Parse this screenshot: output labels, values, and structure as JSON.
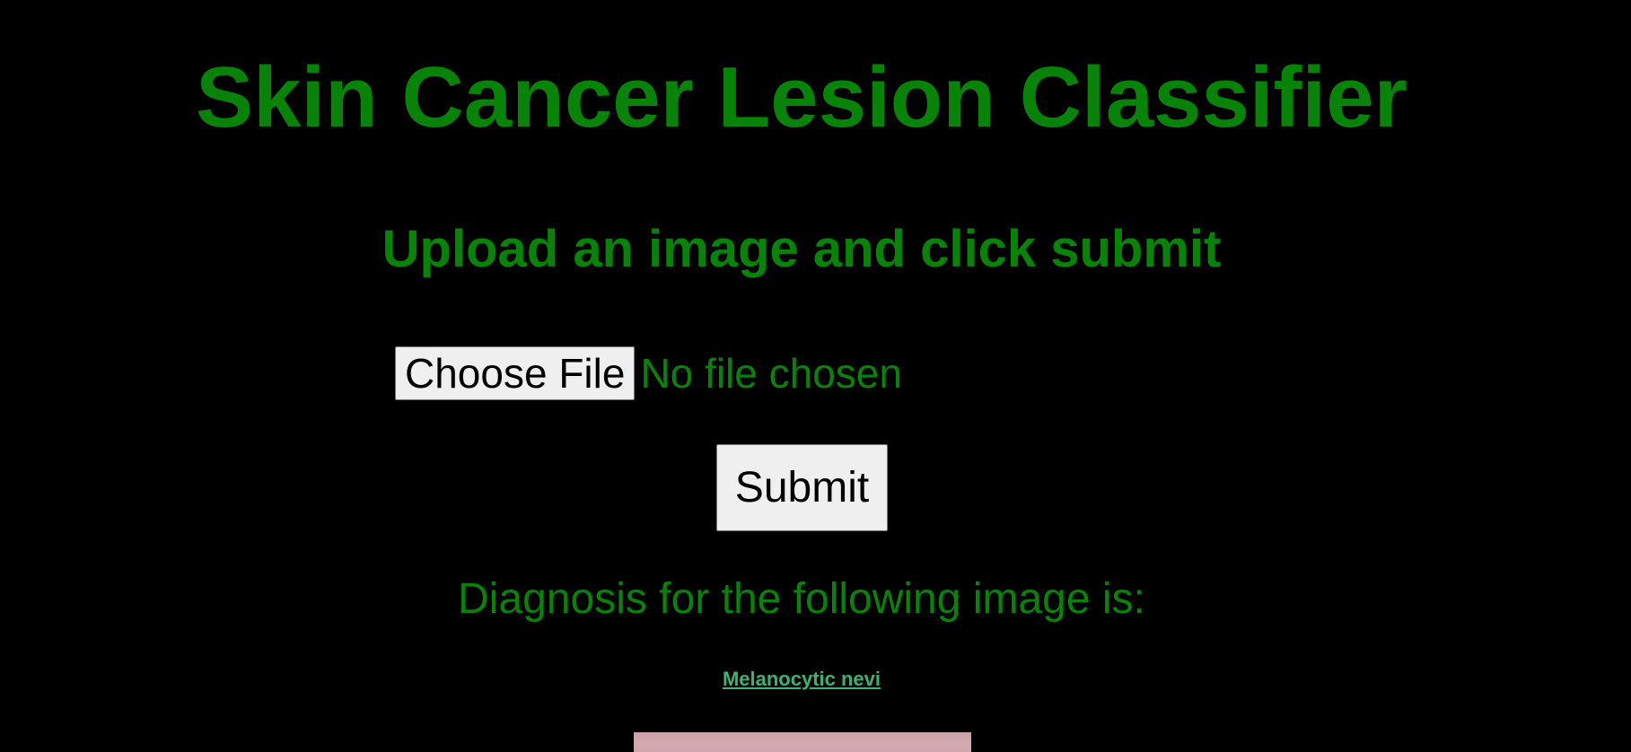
{
  "header": {
    "title": "Skin Cancer Lesion Classifier",
    "subtitle": "Upload an image and click submit"
  },
  "upload_form": {
    "choose_file_label": "Choose File",
    "file_status": "No file chosen",
    "submit_label": "Submit"
  },
  "result": {
    "label": "Diagnosis for the following image is:",
    "diagnosis": "Melanocytic nevi"
  },
  "colors": {
    "background": "#000000",
    "accent_green": "#078407",
    "link_green": "#3cb371"
  }
}
